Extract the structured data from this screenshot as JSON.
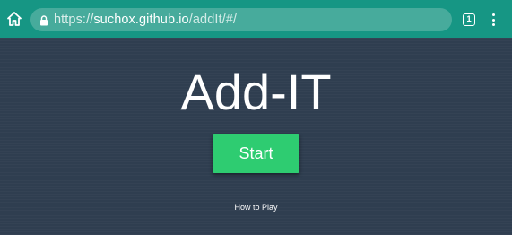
{
  "browser": {
    "url_scheme": "https://",
    "url_host": "suchox.github.io",
    "url_path": "/addIt/#/",
    "tab_count": "1",
    "icons": {
      "home": "home-icon",
      "lock": "lock-icon",
      "tabs": "tab-switcher-icon",
      "menu": "overflow-menu-icon"
    },
    "colors": {
      "toolbar": "#169684",
      "urlbar": "#47ab9c"
    }
  },
  "app": {
    "title": "Add-IT",
    "start_label": "Start",
    "how_to_play_label": "How to Play",
    "colors": {
      "background": "#2f3e50",
      "start_button": "#2ecc71"
    }
  }
}
